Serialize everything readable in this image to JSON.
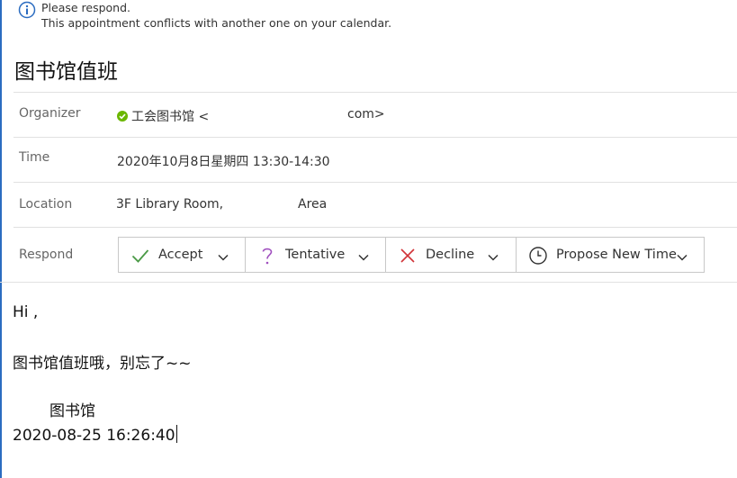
{
  "colors": {
    "accent": "#2b6cc0",
    "presence_available": "#6bb700",
    "accept_icon": "#4a9a46",
    "tentative_icon": "#a04fbf",
    "decline_icon": "#d13438"
  },
  "info_bar": {
    "icon": "info-circle-icon",
    "line1": "Please respond.",
    "line2": "This appointment conflicts with another one on your calendar."
  },
  "subject": "图书馆值班",
  "details": {
    "organizer": {
      "label": "Organizer",
      "name": "工会图书馆 <",
      "email_tail": "com>",
      "presence": "available"
    },
    "time": {
      "label": "Time",
      "value": "2020年10月8日星期四 13:30-14:30"
    },
    "location": {
      "label": "Location",
      "value": "3F Library Room,",
      "value_tail": "Area"
    },
    "respond": {
      "label": "Respond",
      "buttons": [
        {
          "label": "Accept",
          "icon": "checkmark-icon"
        },
        {
          "label": "Tentative",
          "icon": "question-mark-icon"
        },
        {
          "label": "Decline",
          "icon": "x-icon"
        },
        {
          "label": "Propose New Time",
          "icon": "clock-icon"
        }
      ]
    }
  },
  "message_body": {
    "greeting": "Hi ,",
    "line1": "图书馆值班哦，别忘了~~",
    "signature": "图书馆",
    "timestamp": "2020-08-25 16:26:40"
  }
}
